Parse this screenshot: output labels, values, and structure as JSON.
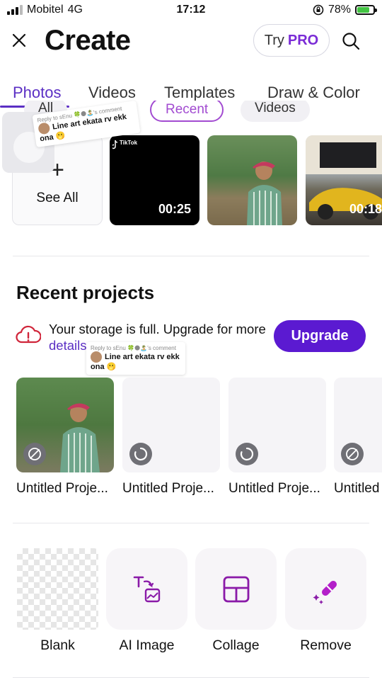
{
  "status_bar": {
    "carrier": "Mobitel",
    "network": "4G",
    "time": "17:12",
    "battery": "78%",
    "battery_level": 0.78
  },
  "header": {
    "title": "Create",
    "try_label": "Try",
    "pro_label": "PRO"
  },
  "tabs": [
    "Photos",
    "Videos",
    "Templates",
    "Draw & Color"
  ],
  "subchips": [
    "All",
    "Recent",
    "Videos"
  ],
  "media": {
    "see_all_label": "See All",
    "items": [
      {
        "duration": "00:25",
        "brand": "TikTok"
      },
      {
        "duration": ""
      },
      {
        "duration": "00:18"
      }
    ]
  },
  "recent_projects": {
    "title": "Recent projects",
    "storage_text": "Your storage is full. Upgrade for more",
    "storage_link": "details.",
    "upgrade_label": "Upgrade",
    "items": [
      {
        "name": "Untitled Proje..."
      },
      {
        "name": "Untitled Proje..."
      },
      {
        "name": "Untitled Proje..."
      },
      {
        "name": "Untitled"
      }
    ]
  },
  "tools": [
    {
      "label": "Blank",
      "icon": "transparent-checker-icon"
    },
    {
      "label": "AI Image",
      "icon": "text-to-image-icon"
    },
    {
      "label": "Collage",
      "icon": "collage-grid-icon"
    },
    {
      "label": "Remove",
      "icon": "magic-eraser-icon"
    }
  ],
  "overlays": [
    {
      "reply": "Reply to sEnu 🍀🌑🏝️'s comment",
      "message": "Line art ekata rv ekk ona 🫢"
    },
    {
      "reply": "Reply to sEnu 🍀🌑🏝️'s comment",
      "message": "Line art ekata rv ekk ona 🫢"
    }
  ],
  "colors": {
    "accent": "#5b2fc4",
    "upgrade": "#5b1ad1",
    "pro": "#7a2bd6",
    "warning": "#d0253a"
  }
}
